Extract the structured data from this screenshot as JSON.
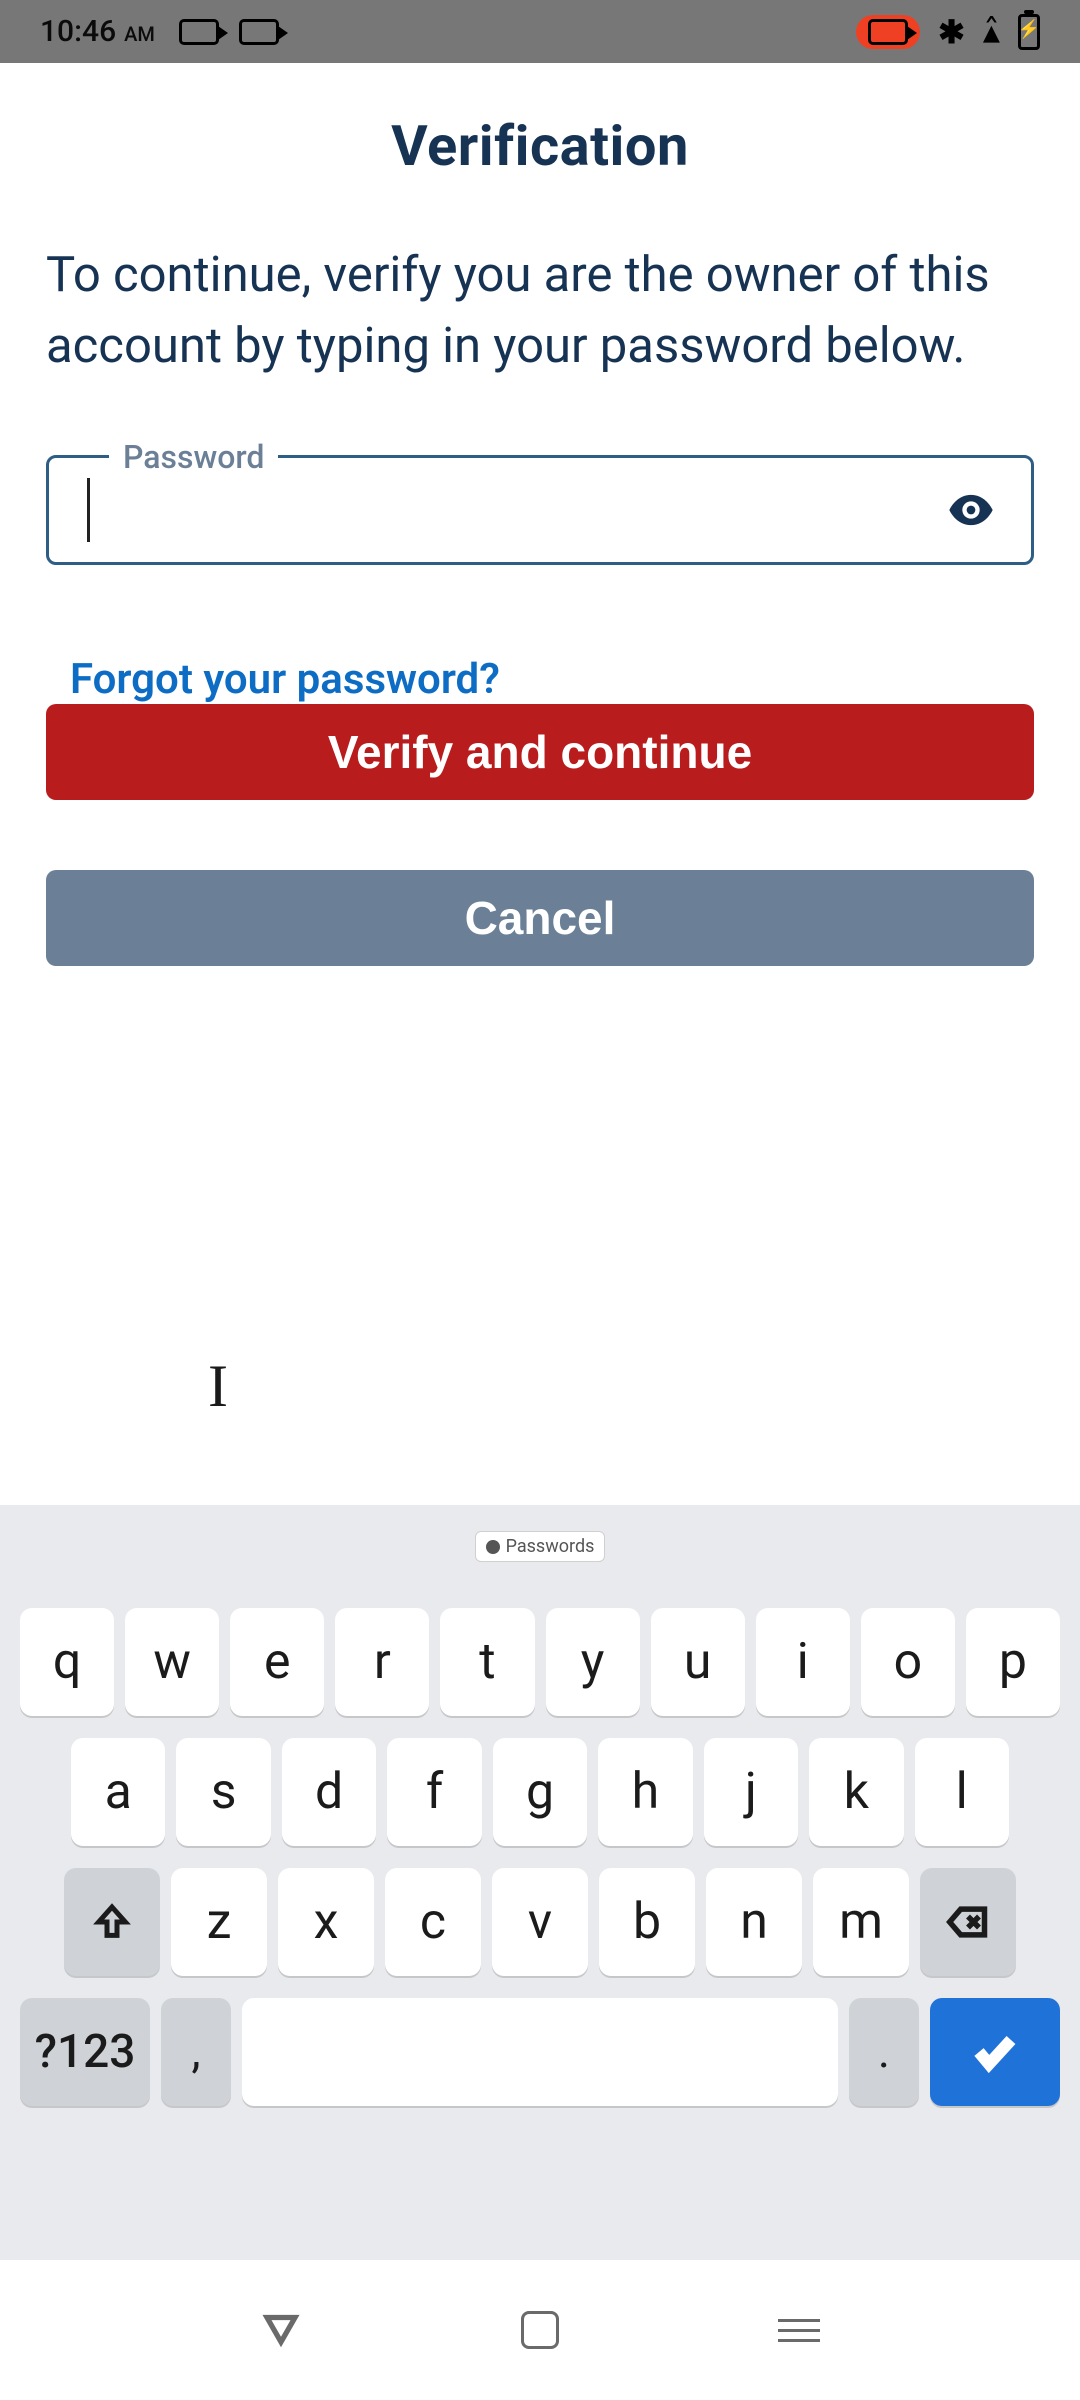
{
  "status": {
    "time": "10:46",
    "ampm": "AM"
  },
  "page": {
    "title": "Verification",
    "subtitle": "To continue, verify you are the owner of this account by typing in your password below.",
    "password_label": "Password",
    "password_value": "",
    "forgot_link": "Forgot your password?",
    "verify_button": "Verify and continue",
    "cancel_button": "Cancel"
  },
  "keyboard": {
    "hint": "Passwords",
    "row1": [
      "q",
      "w",
      "e",
      "r",
      "t",
      "y",
      "u",
      "i",
      "o",
      "p"
    ],
    "row2": [
      "a",
      "s",
      "d",
      "f",
      "g",
      "h",
      "j",
      "k",
      "l"
    ],
    "row3": [
      "z",
      "x",
      "c",
      "v",
      "b",
      "n",
      "m"
    ],
    "symbols_key": "?123",
    "comma_key": ",",
    "dot_key": "."
  }
}
